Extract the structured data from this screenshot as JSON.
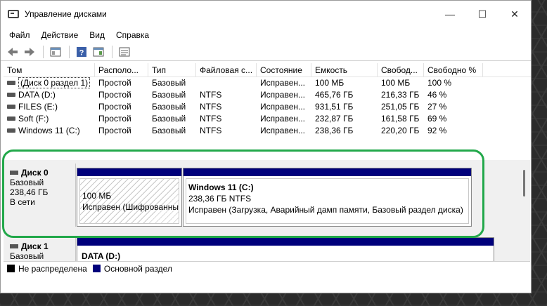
{
  "window": {
    "title": "Управление дисками",
    "controls": {
      "minimize": "—",
      "maximize": "☐",
      "close": "✕"
    }
  },
  "menu": [
    "Файл",
    "Действие",
    "Вид",
    "Справка"
  ],
  "toolbar": {
    "icons": [
      "back-arrow-icon",
      "forward-arrow-icon",
      "properties-icon",
      "help-icon",
      "console-tree-icon",
      "list-view-icon"
    ]
  },
  "volume_list": {
    "columns": [
      "Том",
      "Располо...",
      "Тип",
      "Файловая с...",
      "Состояние",
      "Емкость",
      "Свобод...",
      "Свободно %"
    ],
    "rows": [
      [
        "(Диск 0 раздел 1)",
        "Простой",
        "Базовый",
        "",
        "Исправен...",
        "100 МБ",
        "100 МБ",
        "100 %"
      ],
      [
        "DATA (D:)",
        "Простой",
        "Базовый",
        "NTFS",
        "Исправен...",
        "465,76 ГБ",
        "216,33 ГБ",
        "46 %"
      ],
      [
        "FILES (E:)",
        "Простой",
        "Базовый",
        "NTFS",
        "Исправен...",
        "931,51 ГБ",
        "251,05 ГБ",
        "27 %"
      ],
      [
        "Soft (F:)",
        "Простой",
        "Базовый",
        "NTFS",
        "Исправен...",
        "232,87 ГБ",
        "161,58 ГБ",
        "69 %"
      ],
      [
        "Windows 11 (C:)",
        "Простой",
        "Базовый",
        "NTFS",
        "Исправен...",
        "238,36 ГБ",
        "220,20 ГБ",
        "92 %"
      ]
    ]
  },
  "disks": [
    {
      "name": "Диск 0",
      "type": "Базовый",
      "size": "238,46 ГБ",
      "status": "В сети",
      "partitions": [
        {
          "title": "",
          "size": "100 МБ",
          "status": "Исправен (Шифрованный",
          "hatched": true
        },
        {
          "title": "Windows 11  (C:)",
          "size": "238,36 ГБ NTFS",
          "status": "Исправен (Загрузка, Аварийный дамп памяти, Базовый раздел диска)",
          "hatched": false
        }
      ]
    },
    {
      "name": "Диск 1",
      "type": "Базовый",
      "partitions": [
        {
          "title": "DATA  (D:)"
        }
      ]
    }
  ],
  "legend": [
    {
      "label": "Не распределена",
      "color": "#000000"
    },
    {
      "label": "Основной раздел",
      "color": "#00007b"
    }
  ],
  "highlight_color": "#22a84a"
}
